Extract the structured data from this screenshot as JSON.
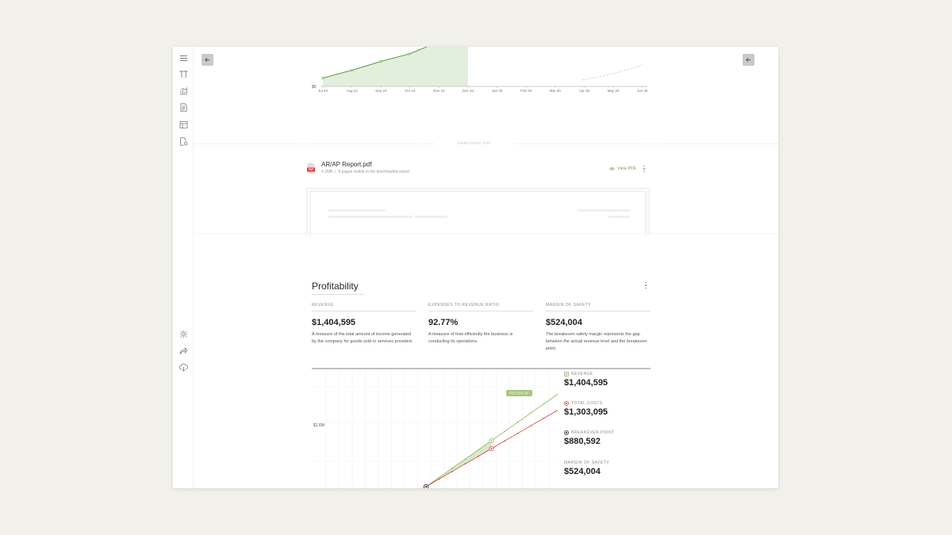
{
  "top_chart": {
    "y_tick": "$0",
    "months": [
      "Jul 24",
      "Aug 24",
      "Sep 24",
      "Oct 24",
      "Nov 24",
      "Dec 24",
      "Jan 25",
      "Feb 25",
      "Mar 25",
      "Apr 25",
      "May 25",
      "Jun 25"
    ],
    "colors": {
      "actual_line": "#5c9a45",
      "actual_fill": "#e2efdc",
      "forecast_line": "#c9c9c9"
    }
  },
  "embed": {
    "section_label": "EMBEDDED PDF",
    "file_name": "AR/AP Report.pdf",
    "file_size": "4.2MB",
    "pages_note": "8 pages visible in the downloaded report",
    "view_label": "View PDF",
    "icon": "pdf-file-icon",
    "icon_label": "PDF",
    "icon_color": "#e03a3a"
  },
  "sidebar": {
    "icons": [
      "menu-icon",
      "text-icon",
      "chart-icon",
      "document-icon",
      "table-icon",
      "file-settings-icon",
      "settings-icon",
      "share-icon",
      "download-icon"
    ]
  },
  "profitability": {
    "title": "Profitability",
    "metrics": [
      {
        "label": "REVENUE",
        "value": "$1,404,595",
        "description": "A measure of the total amount of income generated by the company for goods sold or services provided."
      },
      {
        "label": "EXPENSES TO REVENUE RATIO",
        "value": "92.77%",
        "description": "A measure of how efficiently the business is conducting its operations."
      },
      {
        "label": "MARGIN OF SAFETY",
        "value": "$524,004",
        "description": "The breakeven safety margin represents the gap between the actual revenue level and the breakeven point."
      }
    ],
    "legend": [
      {
        "label": "REVENUE",
        "value": "$1,404,595",
        "icon": "plus-square-icon",
        "color": "#8aab5e"
      },
      {
        "label": "TOTAL COSTS",
        "value": "$1,303,095",
        "icon": "target-icon",
        "color": "#d8403a"
      },
      {
        "label": "BREAKEVEN POINT",
        "value": "$880,592",
        "icon": "target-icon",
        "color": "#1f1f1f"
      },
      {
        "label": "MARGIN OF SAFETY",
        "value": "$524,004",
        "icon": "",
        "color": ""
      }
    ],
    "chart": {
      "y_tick": "$1.6M",
      "revenue_tag": "REVENUE",
      "colors": {
        "revenue": "#8ab35e",
        "costs": "#d8403a",
        "fill": "#cfe2bf",
        "breakeven": "#1f1f1f",
        "tag_bg": "#a8c77c"
      }
    }
  }
}
